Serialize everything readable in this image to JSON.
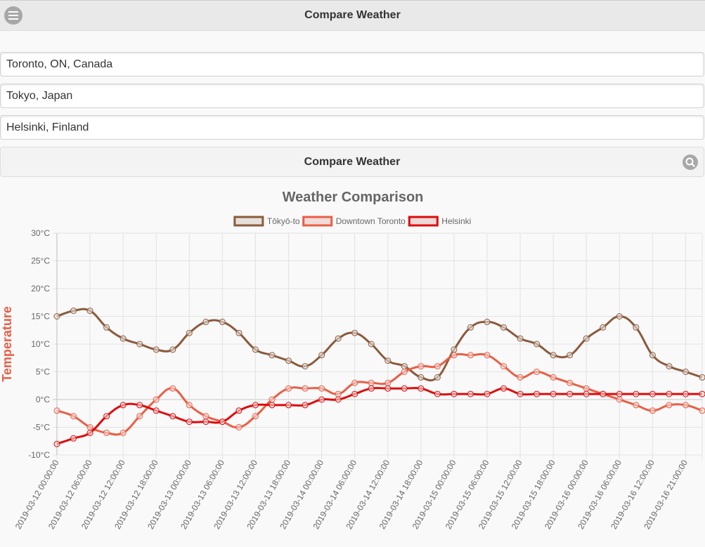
{
  "header": {
    "title": "Compare Weather"
  },
  "locations": [
    {
      "value": "Toronto, ON, Canada"
    },
    {
      "value": "Tokyo, Japan"
    },
    {
      "value": "Helsinki, Finland"
    }
  ],
  "compare_button": {
    "label": "Compare Weather"
  },
  "chart_data": {
    "type": "line",
    "title": "Weather Comparison",
    "ylabel": "Temperature",
    "xlabel": "",
    "ylim": [
      -10,
      30
    ],
    "y_ticks": [
      -10,
      -5,
      0,
      5,
      10,
      15,
      20,
      25,
      30
    ],
    "y_tick_suffix": "°C",
    "x_tick_labels": [
      "2019-03-12 00:00:00",
      "2019-03-12 06:00:00",
      "2019-03-12 12:00:00",
      "2019-03-12 18:00:00",
      "2019-03-13 00:00:00",
      "2019-03-13 06:00:00",
      "2019-03-13 12:00:00",
      "2019-03-13 18:00:00",
      "2019-03-14 00:00:00",
      "2019-03-14 06:00:00",
      "2019-03-14 12:00:00",
      "2019-03-14 18:00:00",
      "2019-03-15 00:00:00",
      "2019-03-15 06:00:00",
      "2019-03-15 12:00:00",
      "2019-03-15 18:00:00",
      "2019-03-16 00:00:00",
      "2019-03-16 06:00:00",
      "2019-03-16 12:00:00",
      "2019-03-16 21:00:00"
    ],
    "x_start": "2019-03-12 00:00:00",
    "x_interval_hours": 3,
    "grid": true,
    "legend_position": "top",
    "series": [
      {
        "name": "Tōkyō-to",
        "color": "#8b5a3c",
        "fill": "#e6e0dc",
        "values": [
          15,
          16,
          16,
          13,
          11,
          10,
          9,
          9,
          12,
          14,
          14,
          12,
          9,
          8,
          7,
          6,
          8,
          11,
          12,
          10,
          7,
          6,
          4,
          4,
          9,
          13,
          14,
          13,
          11,
          10,
          8,
          8,
          11,
          13,
          15,
          13,
          8,
          6,
          5,
          4
        ]
      },
      {
        "name": "Downtown Toronto",
        "color": "#ea5e45",
        "fill": "#f0dcd8",
        "values": [
          -2,
          -3,
          -5,
          -6,
          -6,
          -3,
          0,
          2,
          -1,
          -3,
          -4,
          -5,
          -3,
          0,
          2,
          2,
          2,
          1,
          3,
          3,
          3,
          5,
          6,
          6,
          8,
          8,
          8,
          6,
          4,
          5,
          4,
          3,
          2,
          1,
          0,
          -1,
          -2,
          -1,
          -1,
          -2
        ]
      },
      {
        "name": "Helsinki",
        "color": "#dd0c0c",
        "fill": "#ecd8d8",
        "values": [
          -8,
          -7,
          -6,
          -3,
          -1,
          -1,
          -2,
          -3,
          -4,
          -4,
          -4,
          -2,
          -1,
          -1,
          -1,
          -1,
          0,
          0,
          1,
          2,
          2,
          2,
          2,
          1,
          1,
          1,
          1,
          2,
          1,
          1,
          1,
          1,
          1,
          1,
          1,
          1,
          1,
          1,
          1,
          1
        ]
      }
    ]
  },
  "colors": {
    "axis_label": "#ea5e45",
    "grid": "#e2e2e2",
    "text": "#666666"
  }
}
